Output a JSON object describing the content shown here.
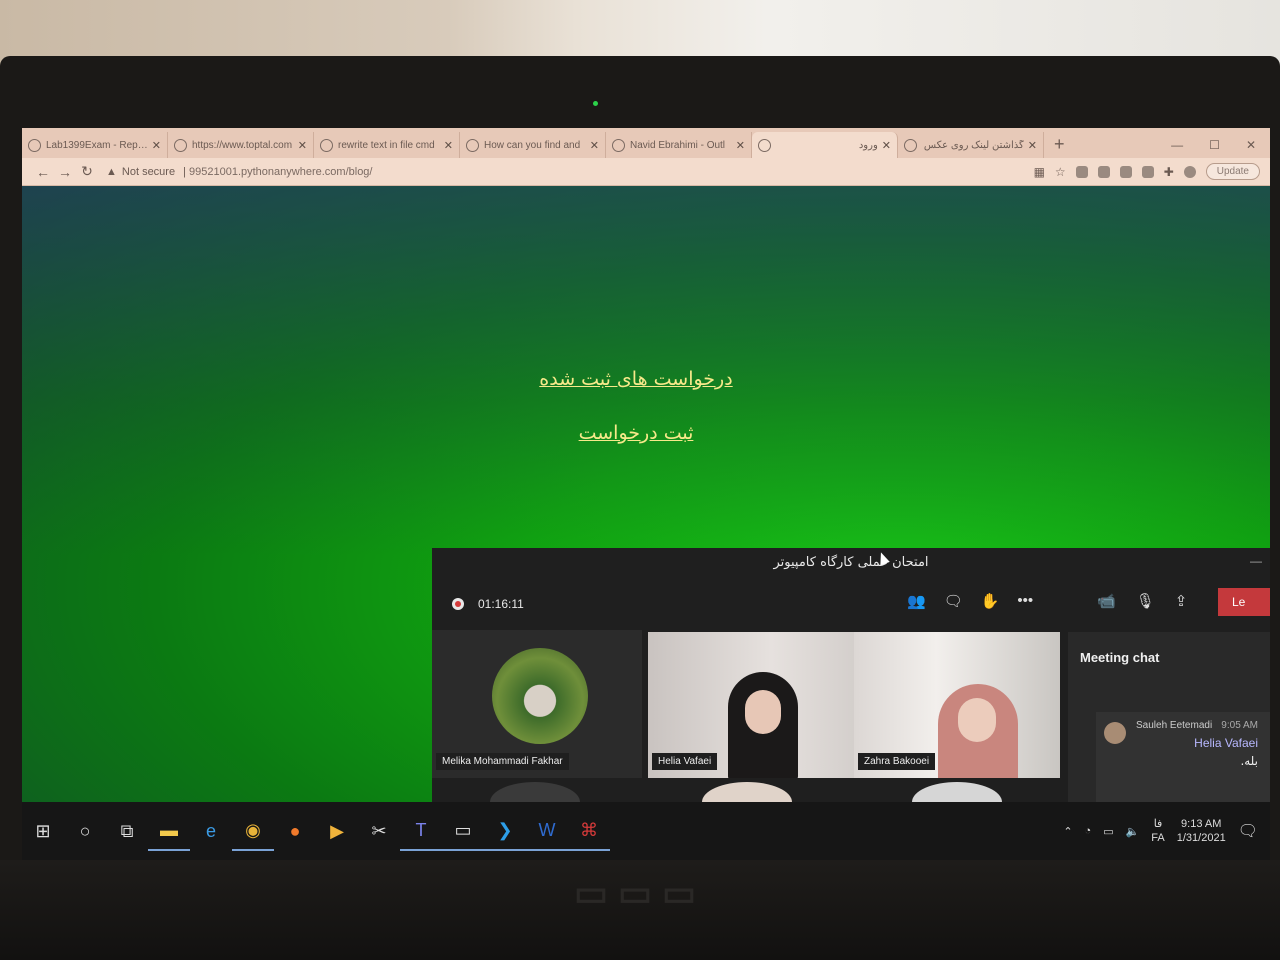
{
  "browser": {
    "tabs": [
      {
        "title": "Lab1399Exam - Repos",
        "active": false
      },
      {
        "title": "https://www.toptal.com",
        "active": false
      },
      {
        "title": "rewrite text in file cmd",
        "active": false
      },
      {
        "title": "How can you find and",
        "active": false
      },
      {
        "title": "Navid Ebrahimi - Outl",
        "active": false
      },
      {
        "title": "ورود",
        "active": true
      },
      {
        "title": "گذاشتن لینک روی عکس",
        "active": false
      }
    ],
    "security_label": "Not secure",
    "url": "99521001.pythonanywhere.com/blog/",
    "update_label": "Update"
  },
  "page": {
    "link_requests": "درخواست های ثبت شده",
    "link_new_request": "ثبت درخواست"
  },
  "teams": {
    "window_title": "امتحان عملی کارگاه کامپیوتر",
    "timer": "01:16:11",
    "leave_label": "Le",
    "participants": [
      "Melika Mohammadi Fakhar",
      "Helia Vafaei",
      "Zahra Bakooei"
    ],
    "chat": {
      "title": "Meeting chat",
      "sender": "Sauleh Eetemadi",
      "time": "9:05 AM",
      "mention": "Helia Vafaei",
      "text": "بله."
    }
  },
  "taskbar": {
    "lang_top": "فا",
    "lang_bottom": "FA",
    "time": "9:13 AM",
    "date": "1/31/2021"
  },
  "colors": {
    "page_green": "#12b012",
    "link_yellow": "#f7e98a",
    "leave_red": "#c4393c"
  }
}
